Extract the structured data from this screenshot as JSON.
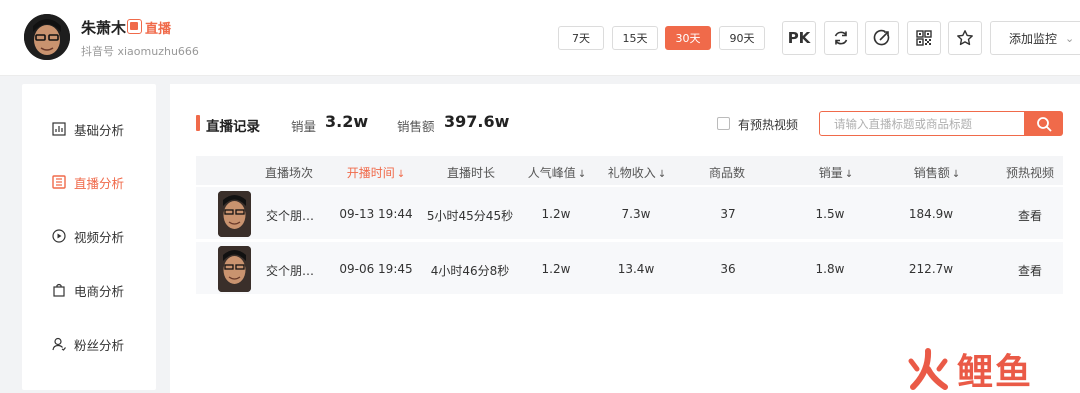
{
  "profile": {
    "name": "朱萧木",
    "live_badge_text": "直播",
    "douyin_id": "抖音号 xiaomuzhu666"
  },
  "day_filters": [
    {
      "label": "7天",
      "active": false
    },
    {
      "label": "15天",
      "active": false
    },
    {
      "label": "30天",
      "active": true
    },
    {
      "label": "90天",
      "active": false
    }
  ],
  "toolbar": {
    "pk_label": "PK",
    "monitor_label": "添加监控"
  },
  "sidebar": {
    "items": [
      {
        "label": "基础分析",
        "icon": "chart-icon",
        "active": false
      },
      {
        "label": "直播分析",
        "icon": "live-icon",
        "active": true
      },
      {
        "label": "视频分析",
        "icon": "play-icon",
        "active": false
      },
      {
        "label": "电商分析",
        "icon": "bag-icon",
        "active": false
      },
      {
        "label": "粉丝分析",
        "icon": "person-icon",
        "active": false
      }
    ]
  },
  "section": {
    "title": "直播记录",
    "sales_label": "销量",
    "sales_value": "3.2w",
    "revenue_label": "销售额",
    "revenue_value": "397.6w",
    "preheat_label": "有预热视频",
    "search_placeholder": "请输入直播标题或商品标题"
  },
  "table": {
    "columns": [
      "直播场次",
      "开播时间",
      "直播时长",
      "人气峰值",
      "礼物收入",
      "商品数",
      "销量",
      "销售额",
      "预热视频"
    ],
    "rows": [
      [
        "交个朋…",
        "09-13 19:44",
        "5小时45分45秒",
        "1.2w",
        "7.3w",
        "37",
        "1.5w",
        "184.9w",
        "查看"
      ],
      [
        "交个朋…",
        "09-06 19:45",
        "4小时46分8秒",
        "1.2w",
        "13.4w",
        "36",
        "1.8w",
        "212.7w",
        "查看"
      ]
    ]
  },
  "watermark": {
    "text": "鲤鱼"
  },
  "colors": {
    "accent": "#f06a4a"
  }
}
